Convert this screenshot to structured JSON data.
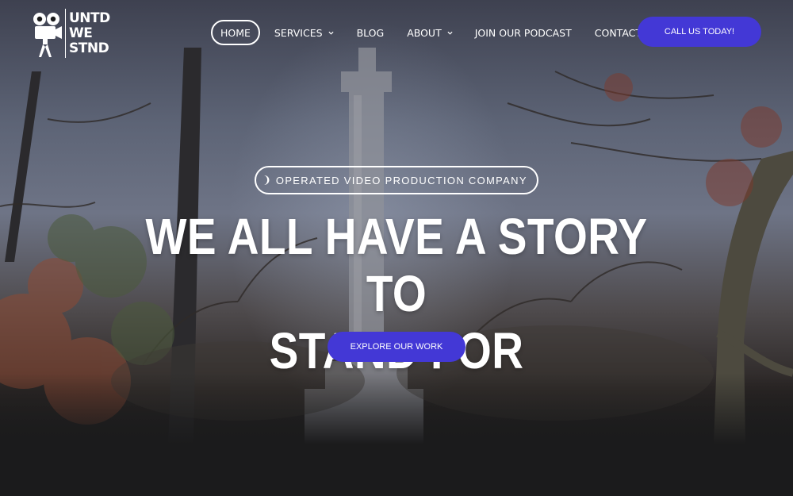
{
  "brand": {
    "logo_lines": [
      "UNTD",
      "WE",
      "STND"
    ],
    "logo_icon": "film-camera-person-icon"
  },
  "nav": {
    "items": [
      {
        "label": "HOME",
        "active": true
      },
      {
        "label": "SERVICES",
        "has_dropdown": true
      },
      {
        "label": "BLOG"
      },
      {
        "label": "ABOUT",
        "has_dropdown": true
      },
      {
        "label": "JOIN OUR PODCAST"
      },
      {
        "label": "CONTACT"
      }
    ],
    "cta_label": "CALL US TODAY!"
  },
  "hero": {
    "tagline_prefix": "❩",
    "tagline": "OPERATED VIDEO PRODUCTION COMPANY",
    "headline_line1": "WE ALL HAVE A STORY TO",
    "headline_line2": "STAND FOR",
    "button_label": "EXPLORE OUR WORK"
  },
  "colors": {
    "accent": "#4338d6",
    "page_background": "#1b1b1c"
  }
}
